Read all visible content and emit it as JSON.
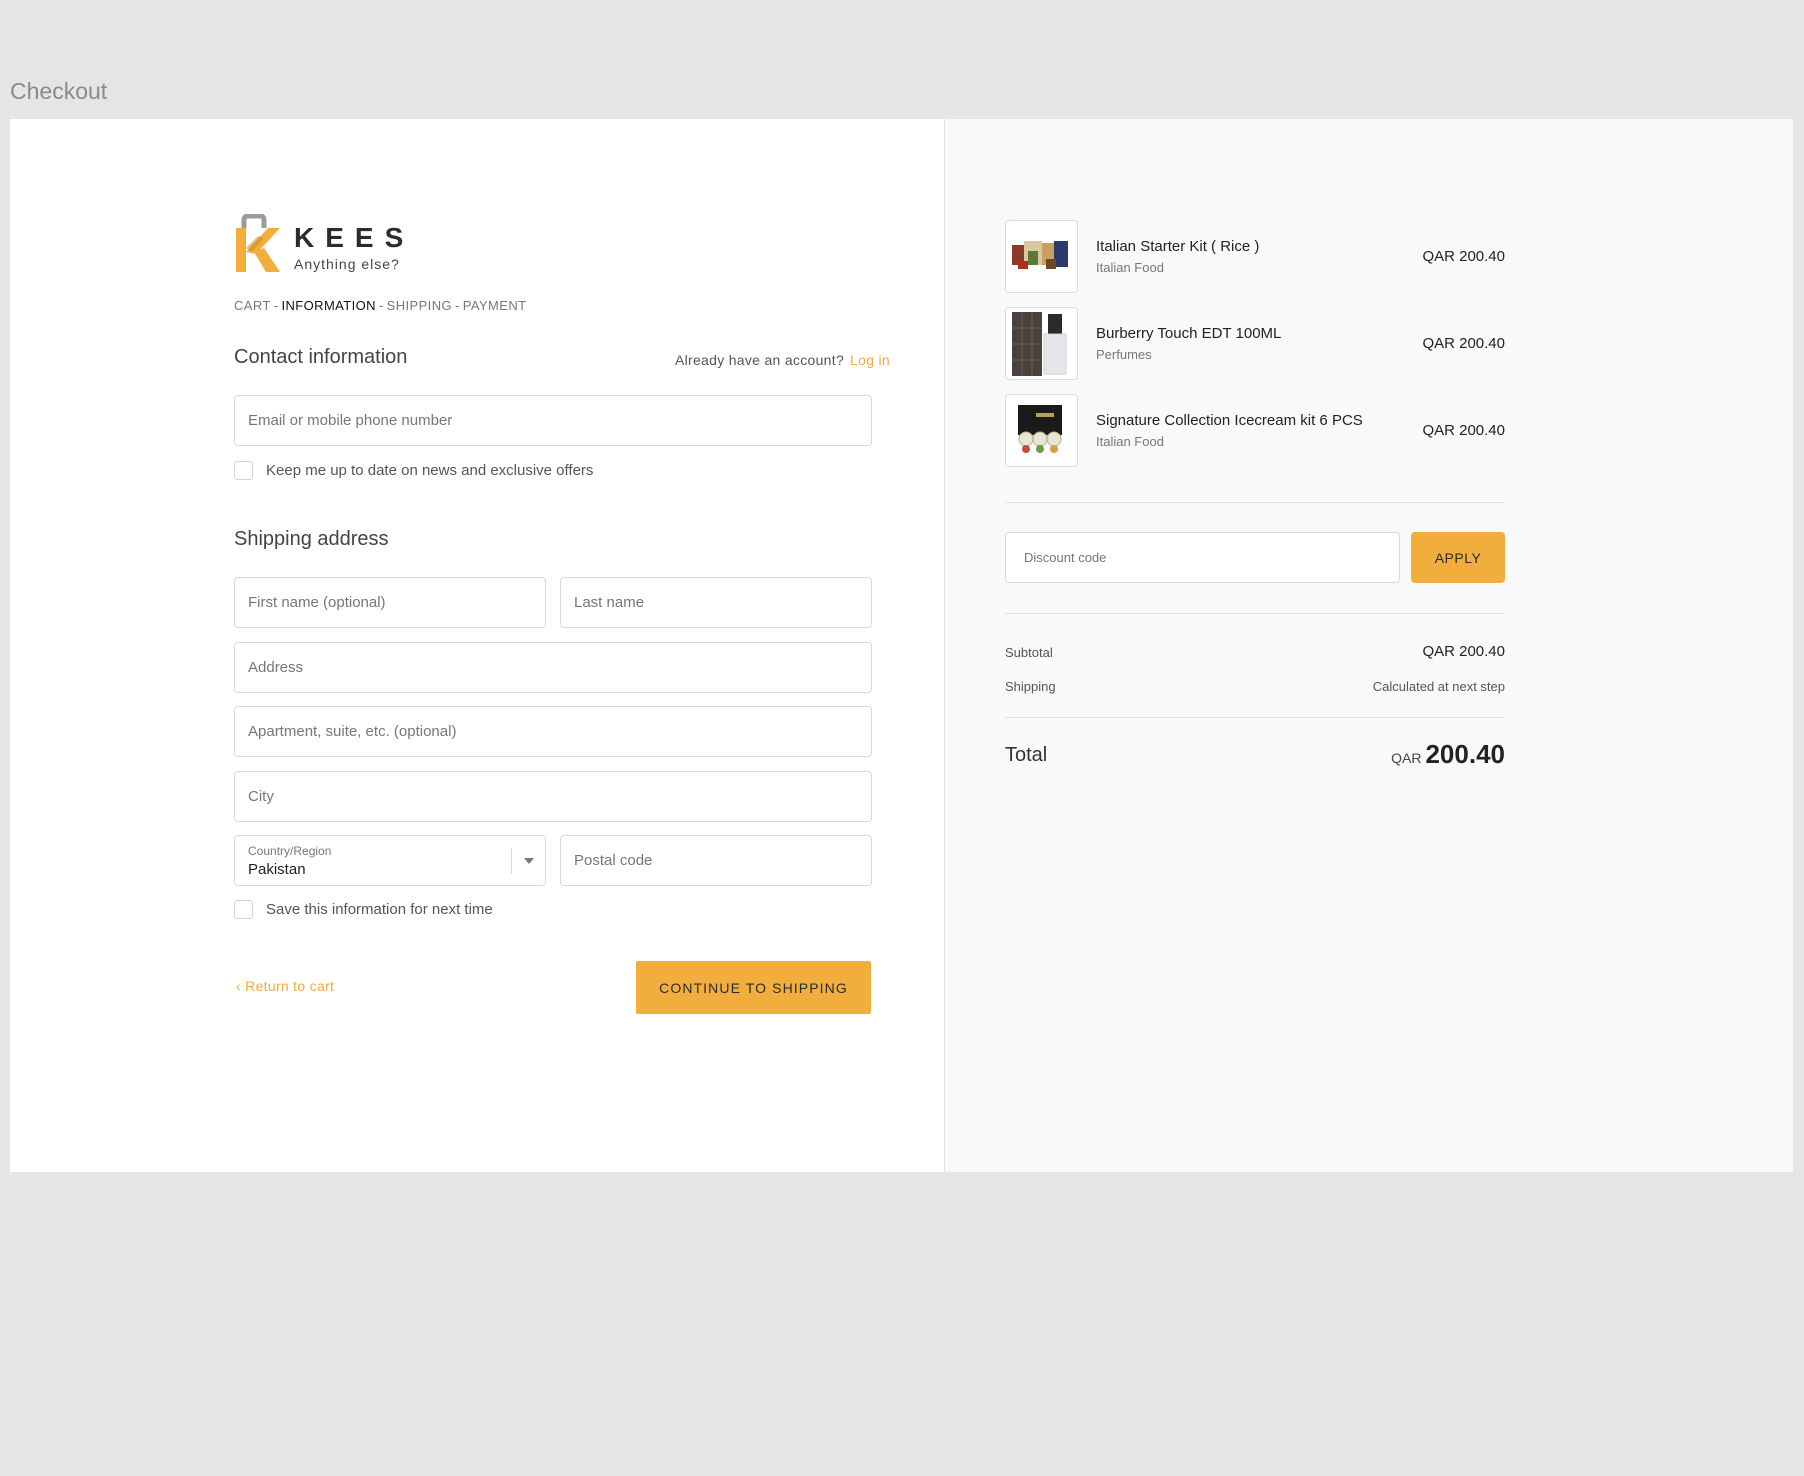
{
  "page_heading": "Checkout",
  "brand": {
    "name": "KEES",
    "tagline": "Anything else?",
    "colors": {
      "accent": "#f2ae3d",
      "mark_gray": "#9b9b9b"
    }
  },
  "breadcrumb": {
    "cart": "CART",
    "information": "INFORMATION",
    "shipping": "SHIPPING",
    "payment": "PAYMENT",
    "separator": "-"
  },
  "contact": {
    "title": "Contact information",
    "account_prompt": "Already have an account?",
    "login_label": "Log in",
    "email_placeholder": "Email or mobile phone number",
    "newsletter_label": "Keep me up to date on news and exclusive offers"
  },
  "shipping": {
    "title": "Shipping address",
    "first_name_placeholder": "First name (optional)",
    "last_name_placeholder": "Last name",
    "address_placeholder": "Address",
    "apartment_placeholder": "Apartment, suite, etc. (optional)",
    "city_placeholder": "City",
    "country_label": "Country/Region",
    "country_value": "Pakistan",
    "postal_placeholder": "Postal code",
    "save_label": "Save this information for next time"
  },
  "actions": {
    "return_label": "Return to cart",
    "return_icon": "chevron-left-icon",
    "continue_label": "CONTINUE TO SHIPPING"
  },
  "order": {
    "items": [
      {
        "name": "Italian Starter Kit ( Rice )",
        "category": "Italian Food",
        "price": "QAR 200.40"
      },
      {
        "name": "Burberry Touch EDT 100ML",
        "category": "Perfumes",
        "price": "QAR 200.40"
      },
      {
        "name": "Signature Collection Icecream kit 6 PCS",
        "category": "Italian Food",
        "price": "QAR 200.40"
      }
    ],
    "discount_placeholder": "Discount code",
    "apply_label": "APPLY",
    "subtotal_label": "Subtotal",
    "subtotal_value": "QAR 200.40",
    "shipping_label": "Shipping",
    "shipping_value": "Calculated at next step",
    "total_label": "Total",
    "total_currency": "QAR",
    "total_value": "200.40"
  }
}
